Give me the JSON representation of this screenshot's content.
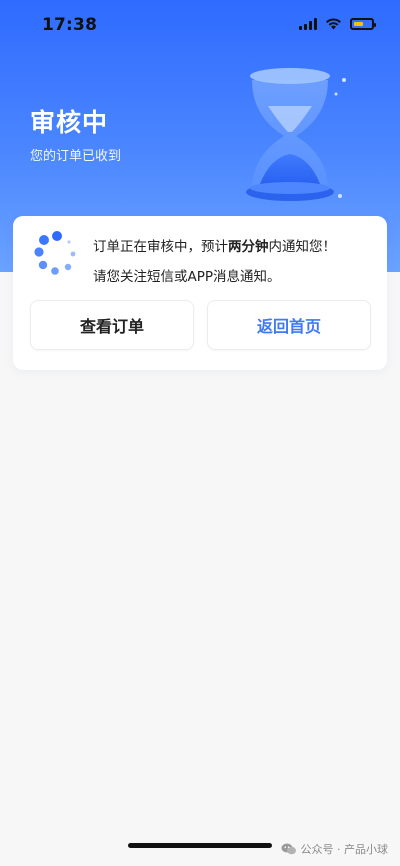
{
  "status_bar": {
    "time": "17:38",
    "signal_icon": "cellular-signal-icon",
    "wifi_icon": "wifi-icon",
    "battery_icon": "battery-icon",
    "battery_color": "#f4c400"
  },
  "header": {
    "title": "审核中",
    "subtitle": "您的订单已收到",
    "illustration": "hourglass-icon",
    "gradient_top": "#2f6bff",
    "gradient_bottom": "#6aa3ff"
  },
  "card": {
    "spinner_icon": "loading-spinner-icon",
    "line1_prefix": "订单正在审核中，预计",
    "line1_bold": "两分钟",
    "line1_suffix": "内通知您！",
    "line2": "请您关注短信或APP消息通知。",
    "view_order_label": "查看订单",
    "back_home_label": "返回首页",
    "accent_color": "#3f79f3"
  },
  "footer": {
    "watermark_icon": "wechat-icon",
    "watermark_text": "公众号 · 产品小球"
  }
}
